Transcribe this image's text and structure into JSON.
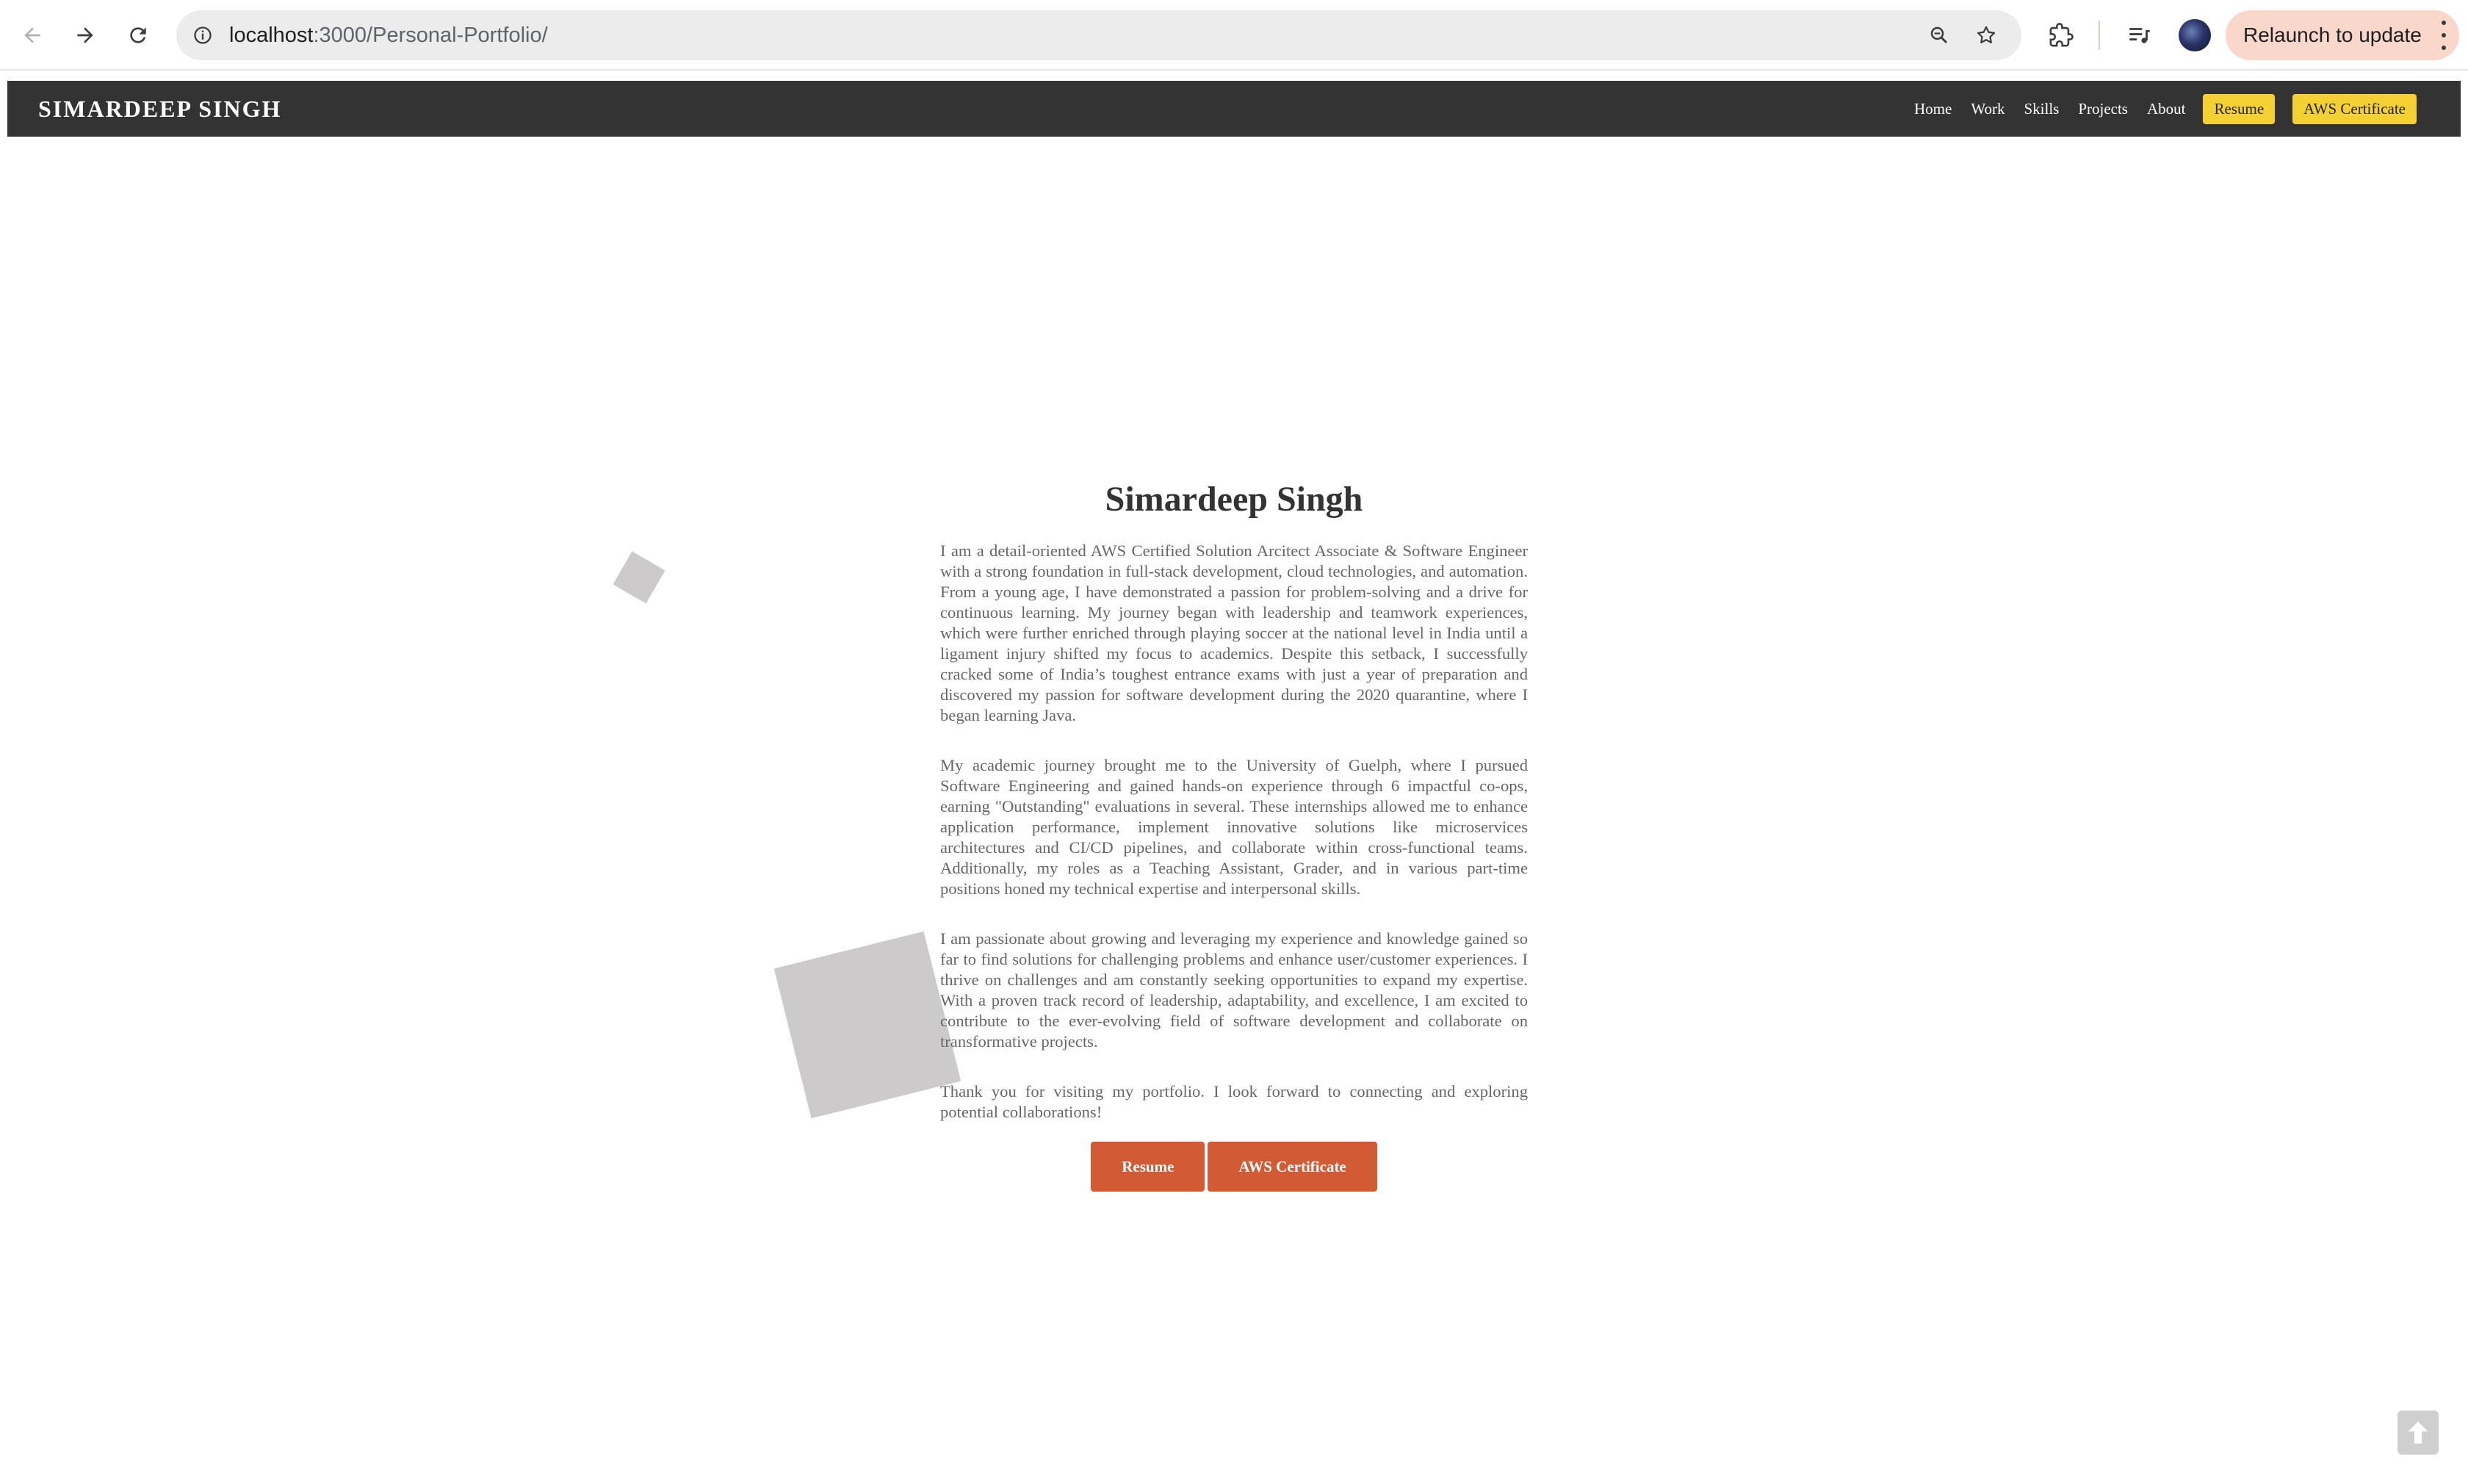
{
  "browser": {
    "url_host": "localhost",
    "url_path": ":3000/Personal-Portfolio/",
    "relaunch_label": "Relaunch to update",
    "icons": [
      "back-icon",
      "forward-icon",
      "reload-icon",
      "site-info-icon",
      "zoom-icon",
      "bookmark-star-icon",
      "extensions-icon",
      "media-control-icon",
      "profile-avatar",
      "more-menu-icon"
    ]
  },
  "nav": {
    "brand": "SIMARDEEP SINGH",
    "links": [
      "Home",
      "Work",
      "Skills",
      "Projects",
      "About"
    ],
    "resume": "Resume",
    "aws": "AWS Certificate",
    "pill_color": "#f5d033",
    "bar_color": "#333333"
  },
  "about": {
    "title": "Simardeep Singh",
    "paragraphs": [
      "I am a detail-oriented AWS Certified Solution Arcitect Associate & Software Engineer with a strong foundation in full-stack development, cloud technologies, and automation. From a young age, I have demonstrated a passion for problem-solving and a drive for continuous learning. My journey began with leadership and teamwork experiences, which were further enriched through playing soccer at the national level in India until a ligament injury shifted my focus to academics. Despite this setback, I successfully cracked some of India’s toughest entrance exams with just a year of preparation and discovered my passion for software development during the 2020 quarantine, where I began learning Java.",
      "My academic journey brought me to the University of Guelph, where I pursued Software Engineering and gained hands-on experience through 6 impactful co-ops, earning \"Outstanding\" evaluations in several. These internships allowed me to enhance application performance, implement innovative solutions like microservices architectures and CI/CD pipelines, and collaborate within cross-functional teams. Additionally, my roles as a Teaching Assistant, Grader, and in various part-time positions honed my technical expertise and interpersonal skills.",
      "I am passionate about growing and leveraging my experience and knowledge gained so far to find solutions for challenging problems and enhance user/customer experiences. I thrive on challenges and am constantly seeking opportunities to expand my expertise. With a proven track record of leadership, adaptability, and excellence, I am excited to contribute to the ever-evolving field of software development and collaborate on transformative projects.",
      "Thank you for visiting my portfolio. I look forward to connecting and exploring potential collaborations!"
    ],
    "resume_button": "Resume",
    "aws_button": "AWS Certificate",
    "button_color": "#d25b35"
  },
  "scroll_top_icon": "arrow-up-icon"
}
